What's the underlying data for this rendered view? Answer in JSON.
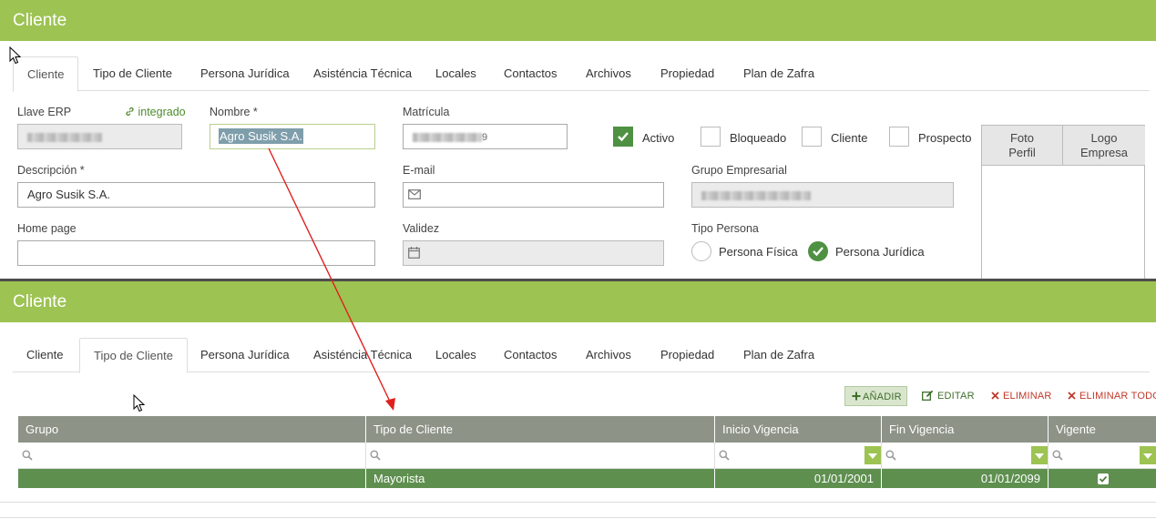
{
  "top": {
    "title": "Cliente",
    "tabs": [
      "Cliente",
      "Tipo de Cliente",
      "Persona Jurídica",
      "Asisténcia Técnica",
      "Locales",
      "Contactos",
      "Archivos",
      "Propiedad",
      "Plan de Zafra"
    ],
    "active_tab": "Cliente",
    "llave_erp": {
      "label": "Llave ERP",
      "link": "integrado"
    },
    "nombre": {
      "label": "Nombre *",
      "value": "Agro Susik S.A."
    },
    "matricula": {
      "label": "Matrícula",
      "value_suffix": "9"
    },
    "checks": [
      {
        "label": "Activo",
        "checked": true
      },
      {
        "label": "Bloqueado",
        "checked": false
      },
      {
        "label": "Cliente",
        "checked": false
      },
      {
        "label": "Prospecto",
        "checked": false
      }
    ],
    "descripcion": {
      "label": "Descripción *",
      "value": "Agro Susik S.A."
    },
    "email": {
      "label": "E-mail",
      "value": ""
    },
    "grupo_empresarial": {
      "label": "Grupo Empresarial"
    },
    "home_page": {
      "label": "Home page",
      "value": ""
    },
    "validez": {
      "label": "Validez",
      "value": ""
    },
    "tipo_persona": {
      "label": "Tipo Persona",
      "options": [
        {
          "label": "Persona Física",
          "selected": false
        },
        {
          "label": "Persona Jurídica",
          "selected": true
        }
      ]
    },
    "photo_tabs": [
      "Foto Perfil",
      "Logo Empresa"
    ]
  },
  "bottom": {
    "title": "Cliente",
    "tabs": [
      "Cliente",
      "Tipo de Cliente",
      "Persona Jurídica",
      "Asisténcia Técnica",
      "Locales",
      "Contactos",
      "Archivos",
      "Propiedad",
      "Plan de Zafra"
    ],
    "active_tab": "Tipo de Cliente",
    "toolbar": {
      "add": "AÑADIR",
      "edit": "EDITAR",
      "delete": "ELIMINAR",
      "delete_all": "ELIMINAR TODOS"
    },
    "grid": {
      "columns": [
        "Grupo",
        "Tipo de Cliente",
        "Inicio Vigencia",
        "Fin Vigencia",
        "Vigente"
      ],
      "rows": [
        {
          "grupo": "",
          "tipo": "Mayorista",
          "inicio": "01/01/2001",
          "fin": "01/01/2099",
          "vigente": true
        }
      ]
    }
  },
  "colors": {
    "header": "#9dc352",
    "accent_green": "#4f9142",
    "row_selected": "#5e8f4f",
    "grid_header": "#8d9387",
    "arrow": "#e02020"
  }
}
